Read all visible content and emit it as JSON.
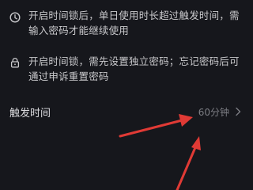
{
  "info": [
    {
      "icon": "clock-icon",
      "text": "开启时间锁后，单日使用时长超过触发时间，需输入密码才能继续使用"
    },
    {
      "icon": "lock-icon",
      "text": "开启时间锁，需先设置独立密码；忘记密码后可通过申诉重置密码"
    }
  ],
  "trigger": {
    "label": "触发时间",
    "value": "60分钟",
    "icon": "chevron-right-icon"
  },
  "annotation": {
    "arrow_color": "#e03a35"
  }
}
